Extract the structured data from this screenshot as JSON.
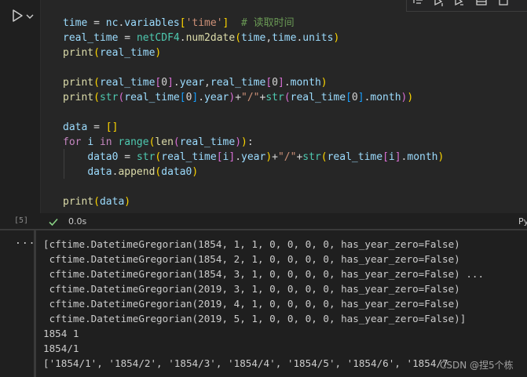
{
  "cell": {
    "execution_count": "[5]",
    "exec_time": "0.0s",
    "kernel_lang_partial": "Py",
    "code_lines": [
      "time = nc.variables['time']  # 读取时间",
      "real_time = netCDF4.num2date(time,time.units)",
      "print(real_time)",
      "",
      "print(real_time[0].year,real_time[0].month)",
      "print(str(real_time[0].year)+\"/\"+str(real_time[0].month))",
      "",
      "data = []",
      "for i in range(len(real_time)):",
      "    data0 = str(real_time[i].year)+\"/\"+str(real_time[i].month)",
      "    data.append(data0)",
      "",
      "print(data)"
    ]
  },
  "output": {
    "menu_glyph": "...",
    "lines": [
      "[cftime.DatetimeGregorian(1854, 1, 1, 0, 0, 0, 0, has_year_zero=False)",
      " cftime.DatetimeGregorian(1854, 2, 1, 0, 0, 0, 0, has_year_zero=False)",
      " cftime.DatetimeGregorian(1854, 3, 1, 0, 0, 0, 0, has_year_zero=False) ...",
      " cftime.DatetimeGregorian(2019, 3, 1, 0, 0, 0, 0, has_year_zero=False)",
      " cftime.DatetimeGregorian(2019, 4, 1, 0, 0, 0, 0, has_year_zero=False)",
      " cftime.DatetimeGregorian(2019, 5, 1, 0, 0, 0, 0, has_year_zero=False)]",
      "1854 1",
      "1854/1",
      "['1854/1', '1854/2', '1854/3', '1854/4', '1854/5', '1854/6', '1854/7"
    ]
  },
  "watermark": "CSDN @捏5个栋",
  "colors": {
    "background": "#1f1f1f",
    "editor_bg": "#262626",
    "keyword": "#c586c0",
    "variable": "#9cdcfe",
    "function": "#dcdcaa",
    "string": "#ce9178",
    "comment": "#6a9955",
    "success_check": "#89d185"
  },
  "icons": [
    "run-cell-icon",
    "chevron-down-icon",
    "success-check-icon",
    "output-more-icon",
    "toolbar-execute-above-icon",
    "toolbar-execute-below-icon",
    "toolbar-split-icon",
    "toolbar-delete-icon"
  ]
}
